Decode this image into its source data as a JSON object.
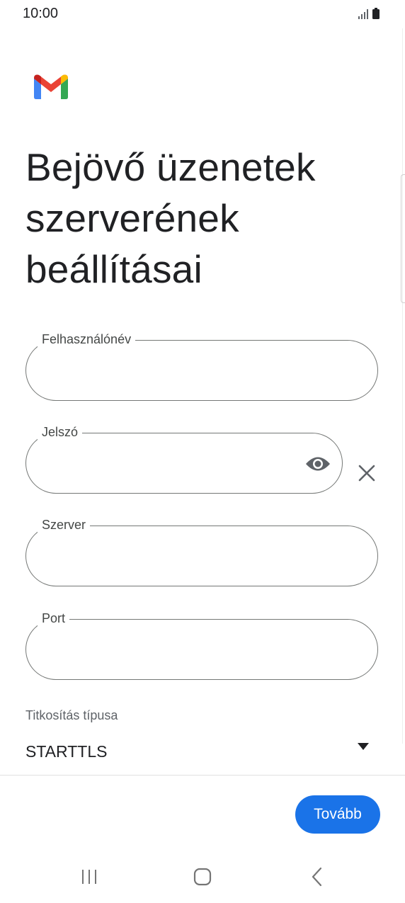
{
  "status_bar": {
    "time": "10:00",
    "icons": [
      "signal-icon",
      "battery-icon"
    ]
  },
  "app": {
    "logo": "gmail-logo"
  },
  "page": {
    "title": "Bejövő üzenetek szerverének beállításai"
  },
  "form": {
    "username": {
      "label": "Felhasználónév",
      "value": ""
    },
    "password": {
      "label": "Jelszó",
      "value": "",
      "show_icon": "eye-icon",
      "clear_icon": "close-icon"
    },
    "server": {
      "label": "Szerver",
      "value": ""
    },
    "port": {
      "label": "Port",
      "value": ""
    },
    "encryption": {
      "label": "Titkosítás típusa",
      "value": "STARTTLS"
    }
  },
  "actions": {
    "next_label": "Tovább"
  },
  "colors": {
    "accent": "#1a73e8",
    "outline": "#747775",
    "text": "#202124"
  },
  "nav": {
    "buttons": [
      "recents-icon",
      "home-icon",
      "back-icon"
    ]
  }
}
